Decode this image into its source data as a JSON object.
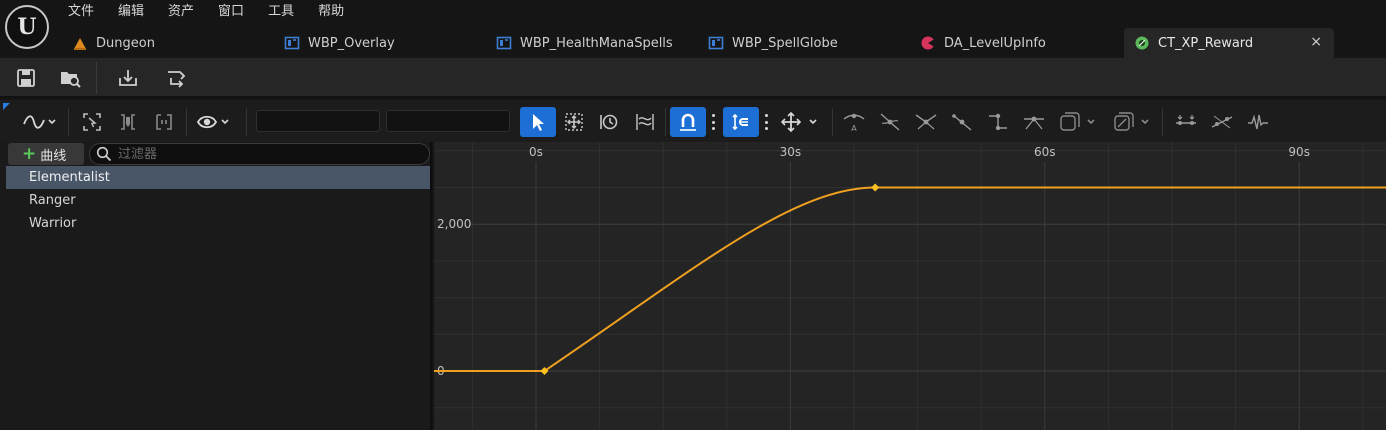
{
  "app": {
    "logo_text": "U"
  },
  "menu": {
    "items": [
      "文件",
      "编辑",
      "资产",
      "窗口",
      "工具",
      "帮助"
    ]
  },
  "tabs": [
    {
      "label": "Dungeon",
      "icon": "level-icon",
      "color": "#e08a1e"
    },
    {
      "label": "WBP_Overlay",
      "icon": "widget-blueprint-icon",
      "color": "#3d7fd6"
    },
    {
      "label": "WBP_HealthManaSpells",
      "icon": "widget-blueprint-icon",
      "color": "#3d7fd6"
    },
    {
      "label": "WBP_SpellGlobe",
      "icon": "widget-blueprint-icon",
      "color": "#3d7fd6"
    },
    {
      "label": "DA_LevelUpInfo",
      "icon": "data-asset-icon",
      "color": "#d6345a"
    },
    {
      "label": "CT_XP_Reward",
      "icon": "curve-table-icon",
      "color": "#5cb85c",
      "active": true,
      "close": "×"
    }
  ],
  "curve_panel": {
    "add_curve_label": "曲线",
    "filter_placeholder": "过滤器",
    "curves": [
      {
        "label": "Elementalist",
        "selected": true
      },
      {
        "label": "Ranger",
        "selected": false
      },
      {
        "label": "Warrior",
        "selected": false
      }
    ]
  },
  "graph": {
    "x_ticks": [
      "0s",
      "30s",
      "60s",
      "90s"
    ],
    "y_ticks": [
      "2,000",
      "0"
    ],
    "curve_color": "#f0a020",
    "keys": [
      {
        "time": 1,
        "value": 0
      },
      {
        "time": 40,
        "value": 2500
      }
    ]
  },
  "colors": {
    "accent_blue": "#1d6fd6",
    "curve": "#f0a020",
    "selection": "#485668"
  }
}
